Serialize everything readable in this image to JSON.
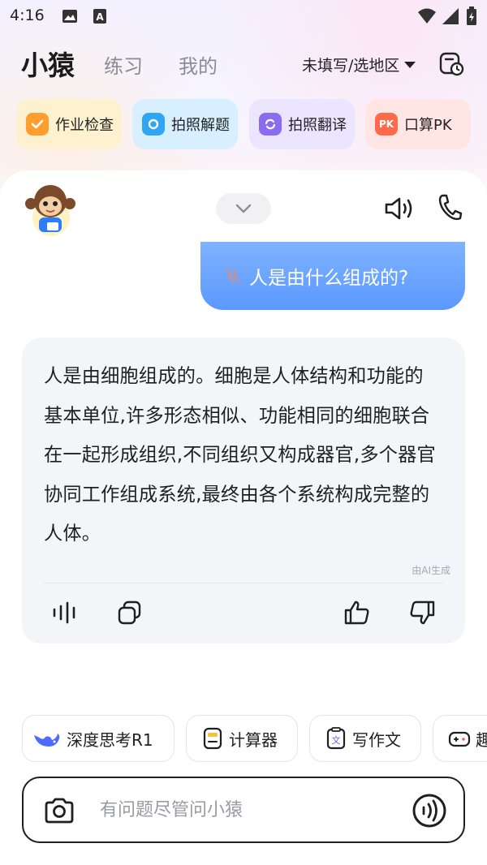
{
  "status_bar": {
    "time": "4:16",
    "icons": [
      "image-icon",
      "a-notification-icon",
      "wifi-icon",
      "signal-icon",
      "battery-icon"
    ]
  },
  "header": {
    "brand": "小猿",
    "tabs": [
      {
        "label": "练习"
      },
      {
        "label": "我的"
      }
    ],
    "region": "未填写/选地区",
    "history_icon": "history-icon"
  },
  "quick_tools": [
    {
      "label": "作业检查",
      "icon": "homework-check-icon",
      "color": "#ff9d2e",
      "bg": "#fdf1cf"
    },
    {
      "label": "拍照解题",
      "icon": "photo-solve-icon",
      "color": "#2fa6f4",
      "bg": "#d7efff"
    },
    {
      "label": "拍照翻译",
      "icon": "photo-translate-icon",
      "color": "#8a6cf0",
      "bg": "#ebe5ff"
    },
    {
      "label": "口算PK",
      "icon": "mental-math-pk-icon",
      "badge": "PK",
      "color": "#ff6b4a",
      "bg": "#ffe6e4"
    }
  ],
  "chat": {
    "user_question": "人是由什么组成的?",
    "answer": "人是由细胞组成的。细胞是人体结构和功能的基本单位,许多形态相似、功能相同的细胞联合在一起形成组织,不同组织又构成器官,多个器官协同工作组成系统,最终由各个系统构成完整的人体。",
    "ai_tag": "由AI生成"
  },
  "chips": [
    {
      "label": "深度思考R1",
      "icon": "deepseek-whale-icon"
    },
    {
      "label": "计算器",
      "icon": "calculator-icon"
    },
    {
      "label": "写作文",
      "icon": "writing-icon"
    },
    {
      "label": "趣",
      "icon": "game-icon"
    }
  ],
  "input": {
    "placeholder": "有问题尽管问小猿"
  },
  "colors": {
    "accent_blue": "#5b98ff",
    "text_dark": "#1f1f1f",
    "muted": "#8b8b95"
  }
}
